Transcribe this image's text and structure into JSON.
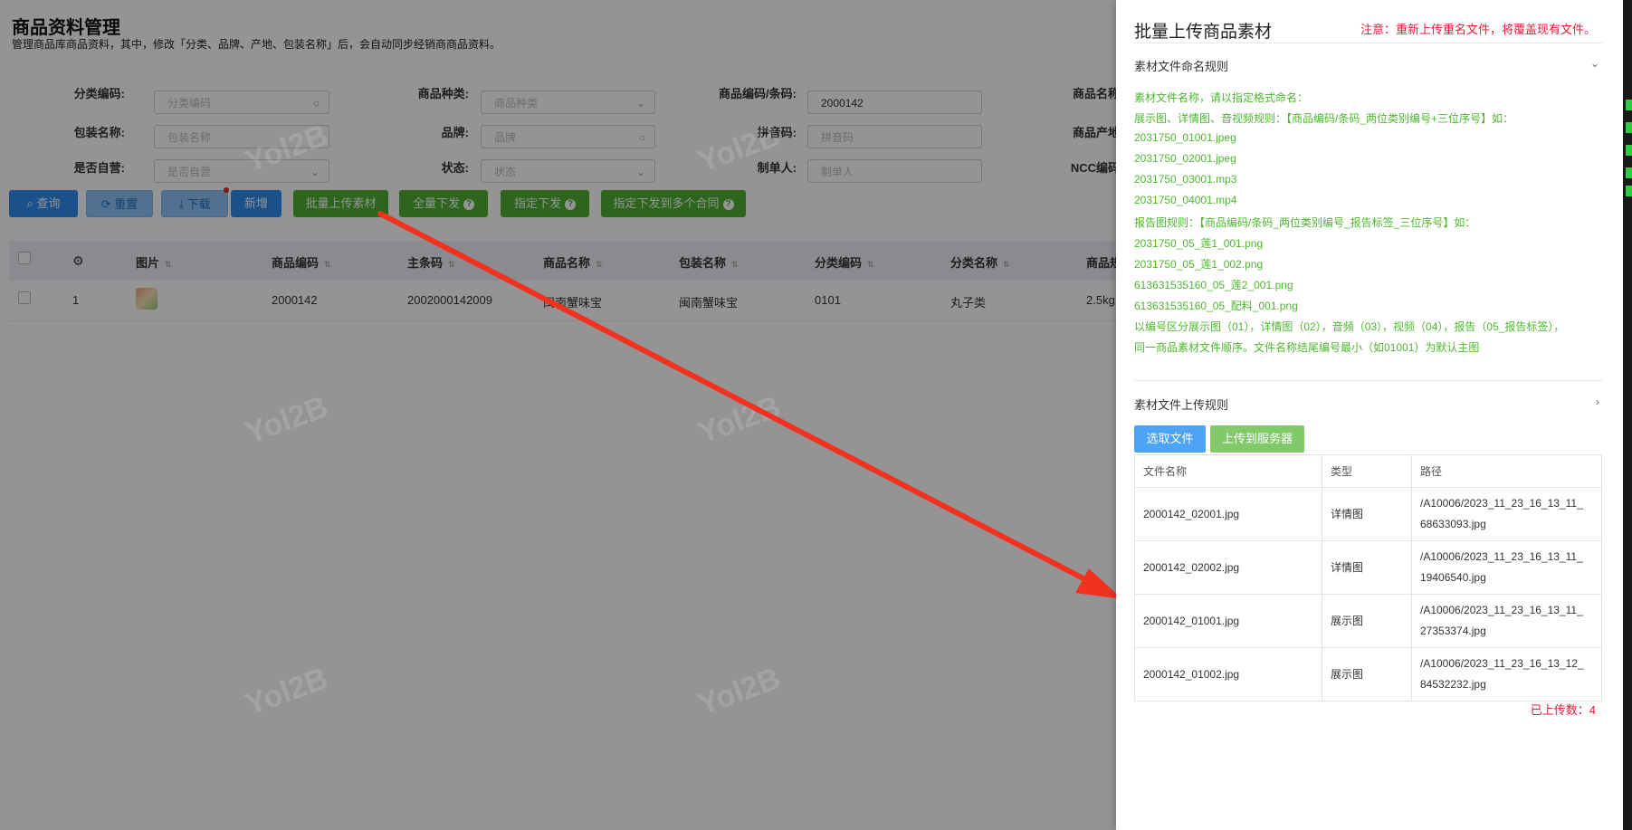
{
  "page": {
    "title": "商品资料管理",
    "subtitle": "管理商品库商品资料，其中，修改「分类、品牌、产地、包装名称」后，会自动同步经销商商品资料。"
  },
  "filters": {
    "category_code_label": "分类编码:",
    "category_code_placeholder": "分类编码",
    "product_type_label": "商品种类:",
    "product_type_placeholder": "商品种类",
    "product_code_label": "商品编码/条码:",
    "product_code_value": "2000142",
    "product_name_label": "商品名称",
    "package_name_label": "包装名称:",
    "package_name_placeholder": "包装名称",
    "brand_label": "品牌:",
    "brand_placeholder": "品牌",
    "pinyin_label": "拼音码:",
    "pinyin_placeholder": "拼音码",
    "origin_label": "商品产地",
    "self_operated_label": "是否自营:",
    "self_operated_placeholder": "是否自营",
    "status_label": "状态:",
    "status_placeholder": "状态",
    "creator_label": "制单人:",
    "creator_placeholder": "制单人",
    "ncc_label": "NCC编码"
  },
  "toolbar": {
    "query": "查询",
    "reset": "重置",
    "download": "下载",
    "add": "新增",
    "batch_upload": "批量上传素材",
    "full_issue": "全量下发",
    "specified_issue": "指定下发",
    "multi_contract_issue": "指定下发到多个合同"
  },
  "table": {
    "headers": {
      "image": "图片",
      "product_code": "商品编码",
      "barcode": "主条码",
      "product_name": "商品名称",
      "package_name": "包装名称",
      "category_code": "分类编码",
      "category_name": "分类名称",
      "spec": "商品规"
    },
    "rows": [
      {
        "index": "1",
        "product_code": "2000142",
        "barcode": "2002000142009",
        "product_name": "闽南蟹味宝",
        "package_name": "闽南蟹味宝",
        "category_code": "0101",
        "category_name": "丸子类",
        "spec": "2.5kg"
      }
    ]
  },
  "watermark": "Yol2B",
  "drawer": {
    "title": "批量上传商品素材",
    "notice": "注意：重新上传重名文件，将覆盖现有文件。",
    "naming_rules_title": "素材文件命名规则",
    "naming_rules": [
      "素材文件名称，请以指定格式命名：",
      "展示图、详情图、音视频规则：【商品编码/条码_两位类别编号+三位序号】如：",
      "2031750_01001.jpeg",
      "2031750_02001.jpeg",
      "2031750_03001.mp3",
      "2031750_04001.mp4",
      "报告图规则：【商品编码/条码_两位类别编号_报告标签_三位序号】如：",
      "2031750_05_莲1_001.png",
      "2031750_05_莲1_002.png",
      "613631535160_05_莲2_001.png",
      "613631535160_05_配料_001.png",
      "以编号区分展示图（01），详情图（02），音频（03），视频（04），报告（05_报告标签），",
      "同一商品素材文件顺序。文件名称结尾编号最小（如01001）为默认主图"
    ],
    "upload_rules_title": "素材文件上传规则",
    "select_file": "选取文件",
    "upload_to_server": "上传到服务器",
    "file_table": {
      "headers": [
        "文件名称",
        "类型",
        "路径"
      ],
      "rows": [
        {
          "name": "2000142_02001.jpg",
          "type": "详情图",
          "path1": "/A10006/2023_11_23_16_13_11_",
          "path2": "68633093.jpg"
        },
        {
          "name": "2000142_02002.jpg",
          "type": "详情图",
          "path1": "/A10006/2023_11_23_16_13_11_",
          "path2": "19406540.jpg"
        },
        {
          "name": "2000142_01001.jpg",
          "type": "展示图",
          "path1": "/A10006/2023_11_23_16_13_11_",
          "path2": "27353374.jpg"
        },
        {
          "name": "2000142_01002.jpg",
          "type": "展示图",
          "path1": "/A10006/2023_11_23_16_13_12_",
          "path2": "84532232.jpg"
        }
      ]
    },
    "uploaded_count": "已上传数：4"
  },
  "colors": {
    "primary_blue": "#2d8cf0",
    "action_green": "#4cae2f",
    "rule_green": "#4cb82e",
    "notice_red": "#e8183a",
    "arrow_red": "#f2311f"
  }
}
